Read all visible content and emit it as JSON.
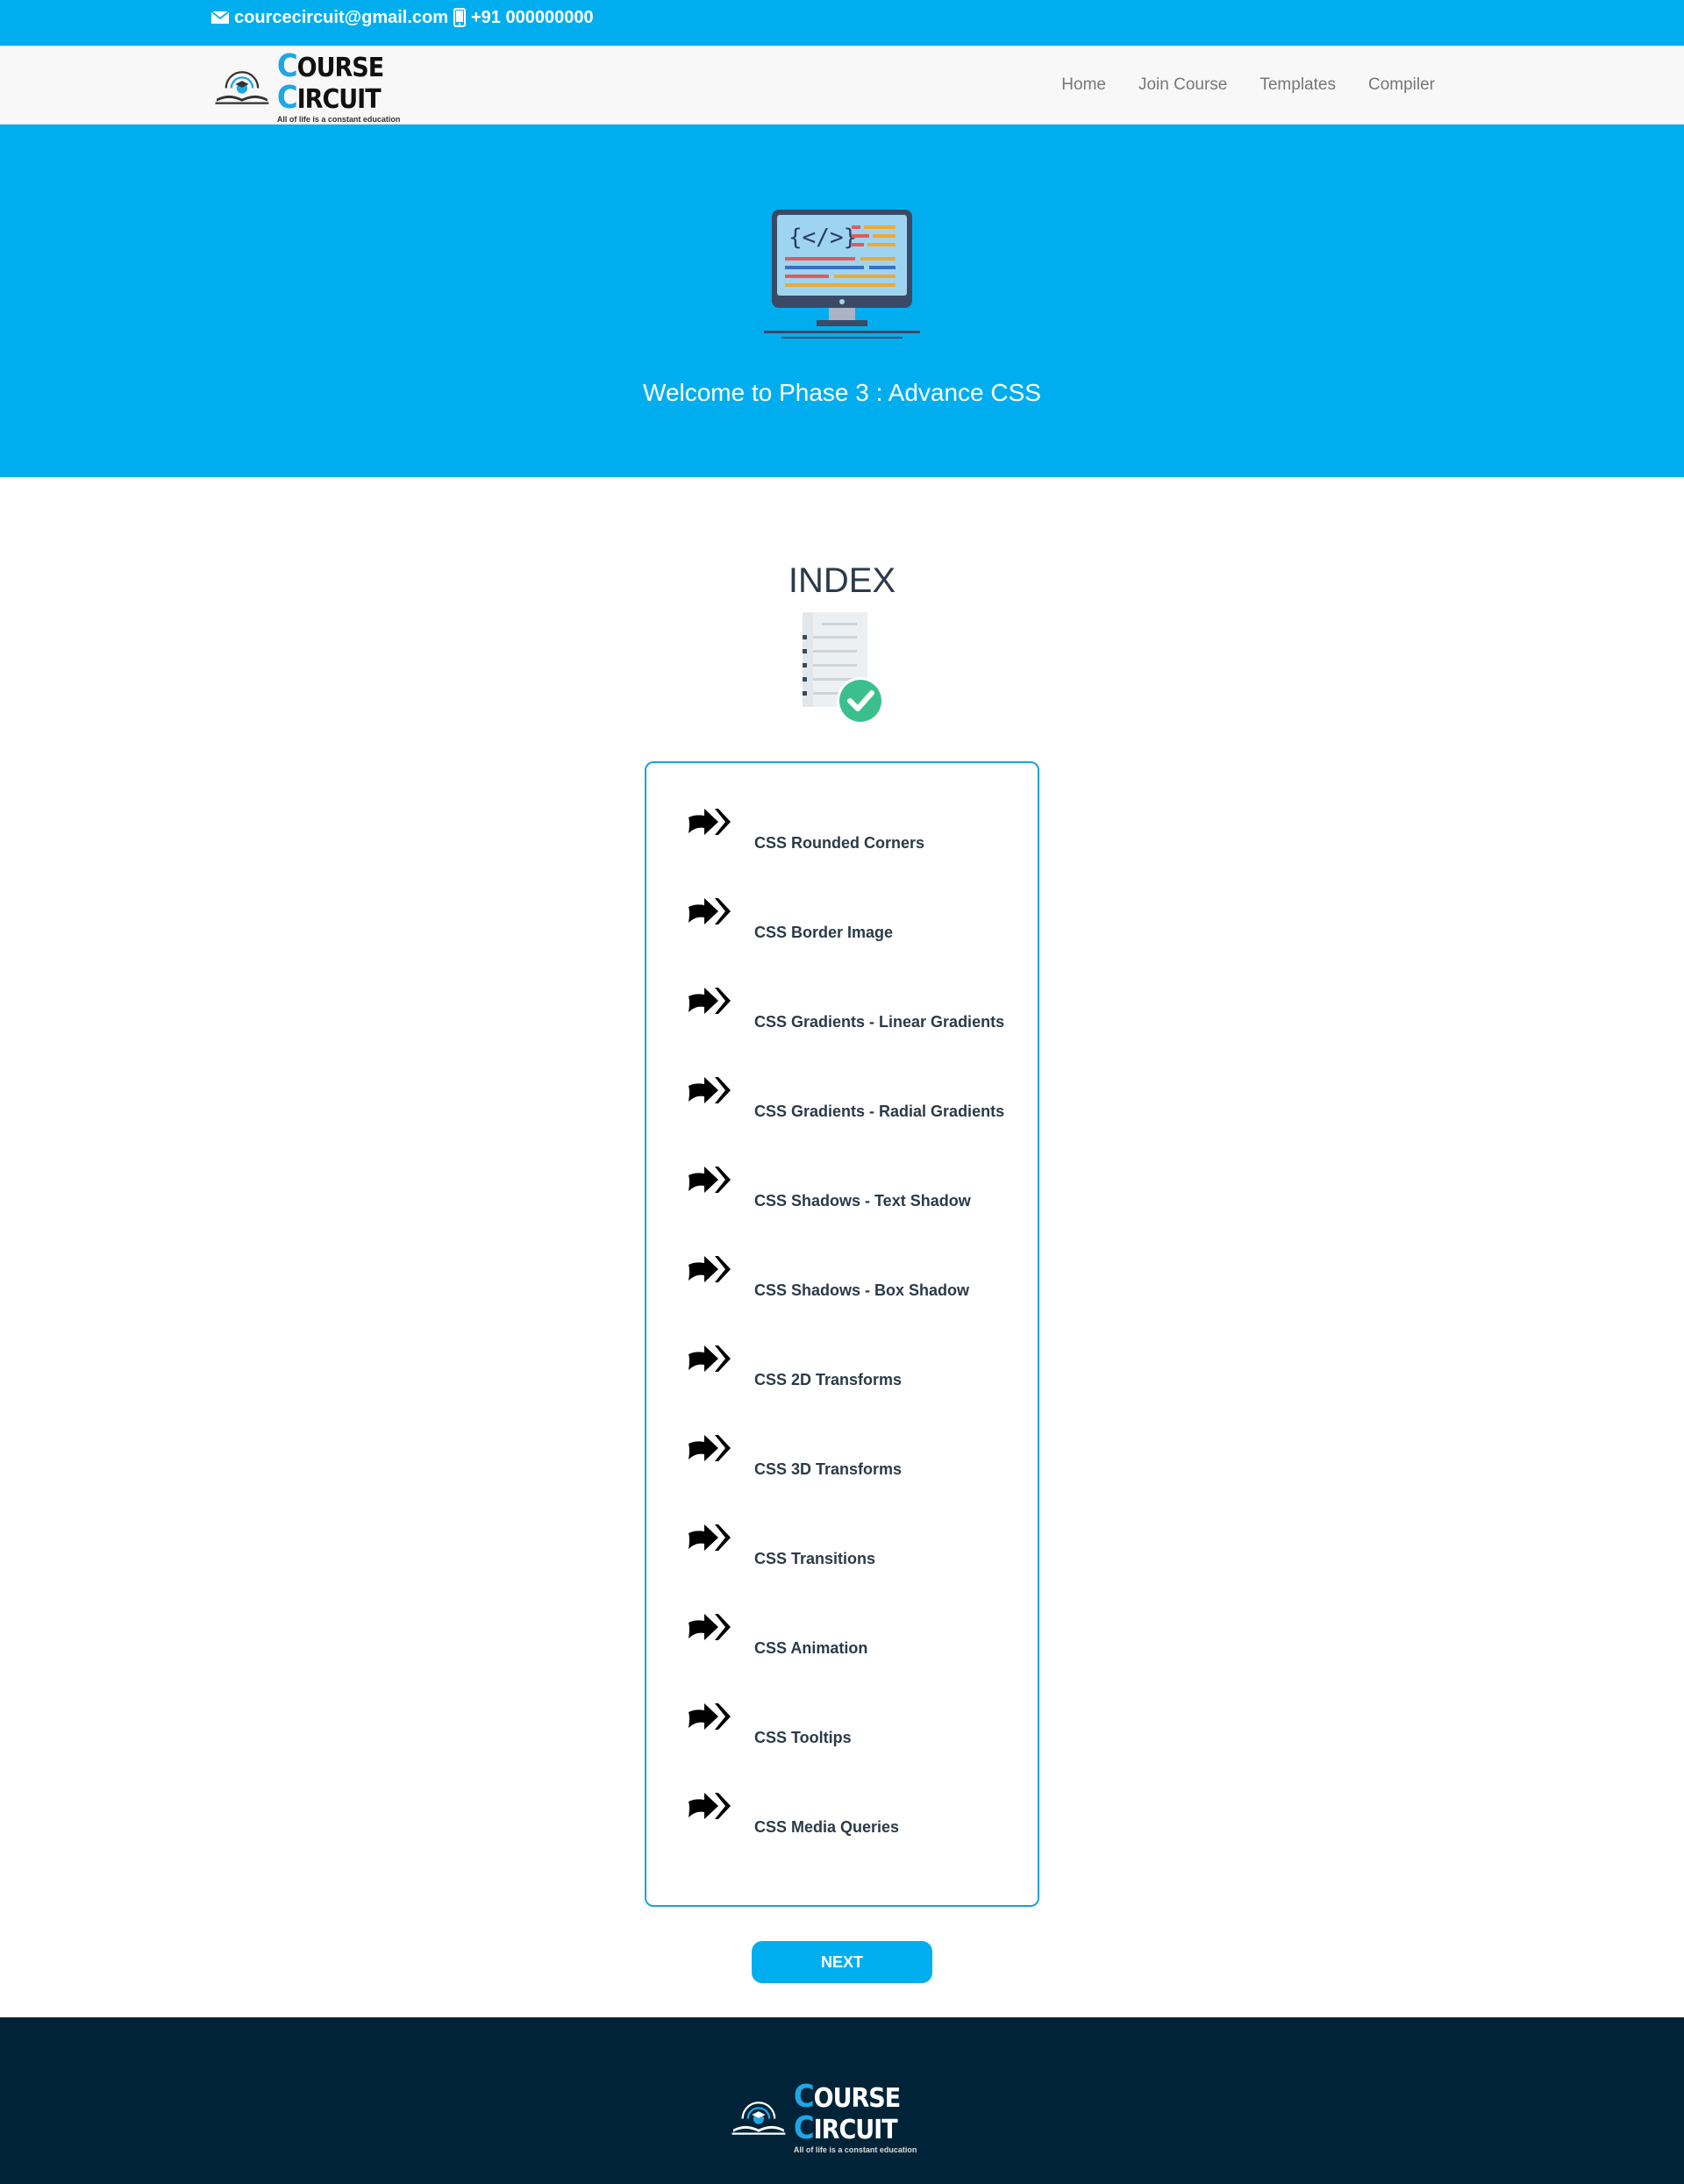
{
  "topbar": {
    "email": "courcecircuit@gmail.com",
    "phone": "+91 000000000",
    "email_icon": "envelope-icon",
    "phone_icon": "mobile-phone-icon"
  },
  "brand": {
    "name_first_letter": "C",
    "name_first_rest": "OURSE",
    "name_second_letter": "C",
    "name_second_rest": "IRCUIT",
    "tagline": "All of life is a constant education",
    "accent": "#1ea6e6"
  },
  "nav": {
    "items": [
      "Home",
      "Join Course",
      "Templates",
      "Compiler"
    ]
  },
  "hero": {
    "title": "Welcome to Phase 3 : Advance CSS",
    "icon": "computer-monitor-code-icon",
    "bg": "#00aeef"
  },
  "index": {
    "title": "INDEX",
    "icon": "document-checklist-icon",
    "items": [
      "CSS Rounded Corners",
      "CSS Border Image",
      "CSS Gradients - Linear Gradients",
      "CSS Gradients - Radial Gradients",
      "CSS Shadows - Text Shadow",
      "CSS Shadows - Box Shadow",
      "CSS 2D Transforms",
      "CSS 3D Transforms",
      "CSS Transitions",
      "CSS Animation",
      "CSS Tooltips",
      "CSS Media Queries"
    ],
    "item_icon": "double-arrow-right-icon"
  },
  "next_button": "NEXT",
  "footer": {
    "bg": "#002338"
  }
}
